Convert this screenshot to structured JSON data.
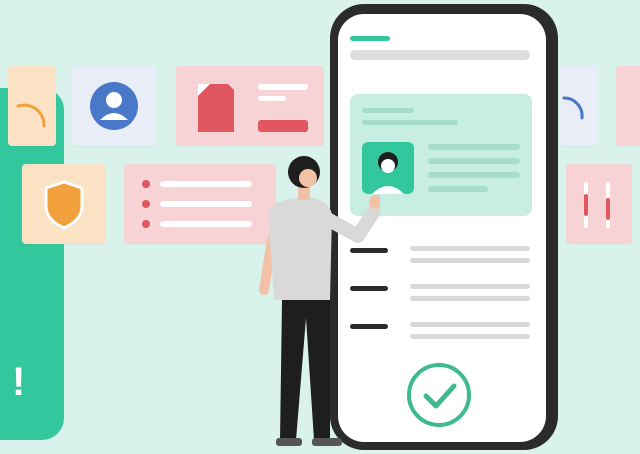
{
  "accent": "#33c79d",
  "check_color": "#3fb98f",
  "panel_text": "!",
  "icons": [
    "person-avatar-icon",
    "shield-icon",
    "document-icon",
    "list-bullet-icon",
    "check-circle-icon"
  ]
}
